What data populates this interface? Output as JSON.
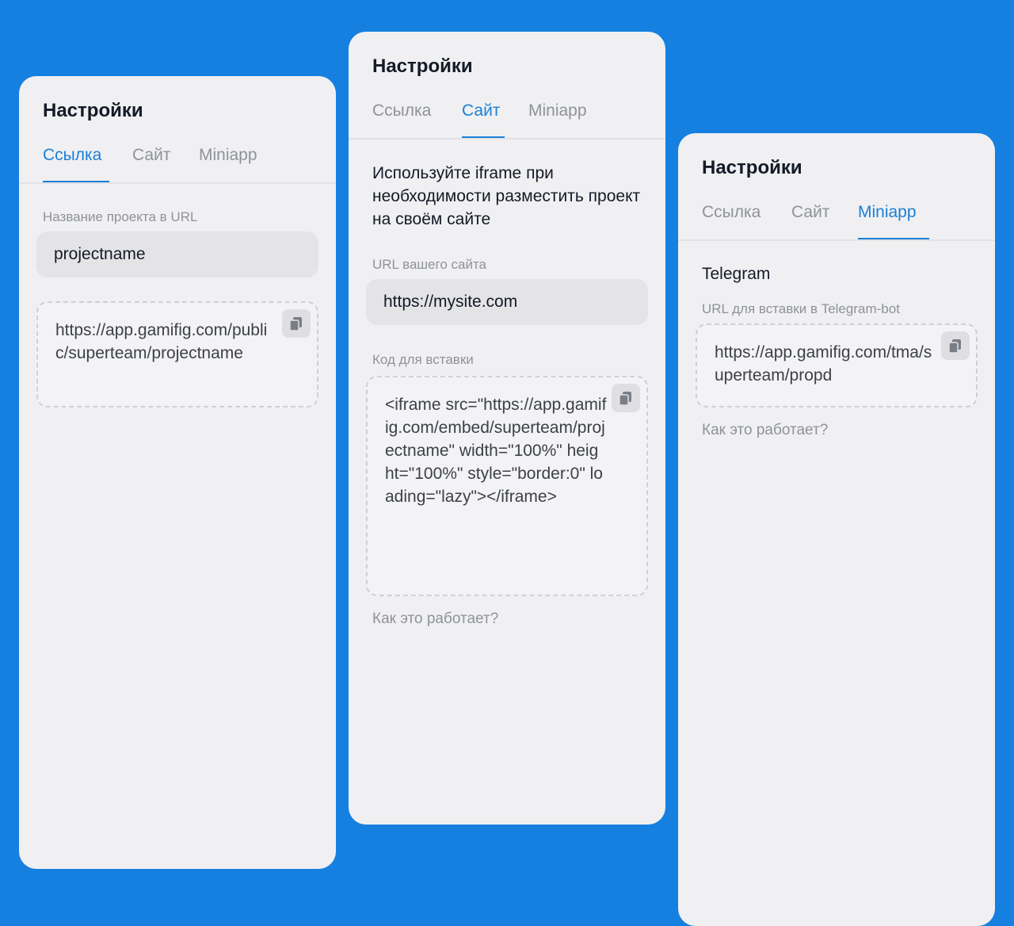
{
  "tabs": [
    "Ссылка",
    "Сайт",
    "Miniapp"
  ],
  "panel_link": {
    "title": "Настройки",
    "project_label": "Название проекта в URL",
    "project_value": "projectname",
    "public_url": "https://app.gamifig.com/public/superteam/projectname"
  },
  "panel_site": {
    "title": "Настройки",
    "description": "Используйте iframe при необходимости разместить проект на своём сайте",
    "site_url_label": "URL вашего сайта",
    "site_url_value": "https://mysite.com",
    "embed_label": "Код для вставки",
    "embed_code": "<iframe src=\"https://app.gamifig.com/embed/superteam/projectname\" width=\"100%\" height=\"100%\" style=\"border:0\" loading=\"lazy\"></iframe>",
    "how_link": "Как это работает?"
  },
  "panel_mini": {
    "title": "Настройки",
    "heading": "Telegram",
    "bot_url_label": "URL для вставки в Telegram-bot",
    "bot_url": "https://app.gamifig.com/tma/superteam/propd",
    "how_link": "Как это работает?"
  },
  "colors": {
    "background": "#1580E0",
    "panel": "#F0F0F2",
    "accent": "#1B7FD6",
    "muted": "#8E929A",
    "text": "#141A26"
  },
  "icons": {
    "copy": "copy-icon"
  }
}
